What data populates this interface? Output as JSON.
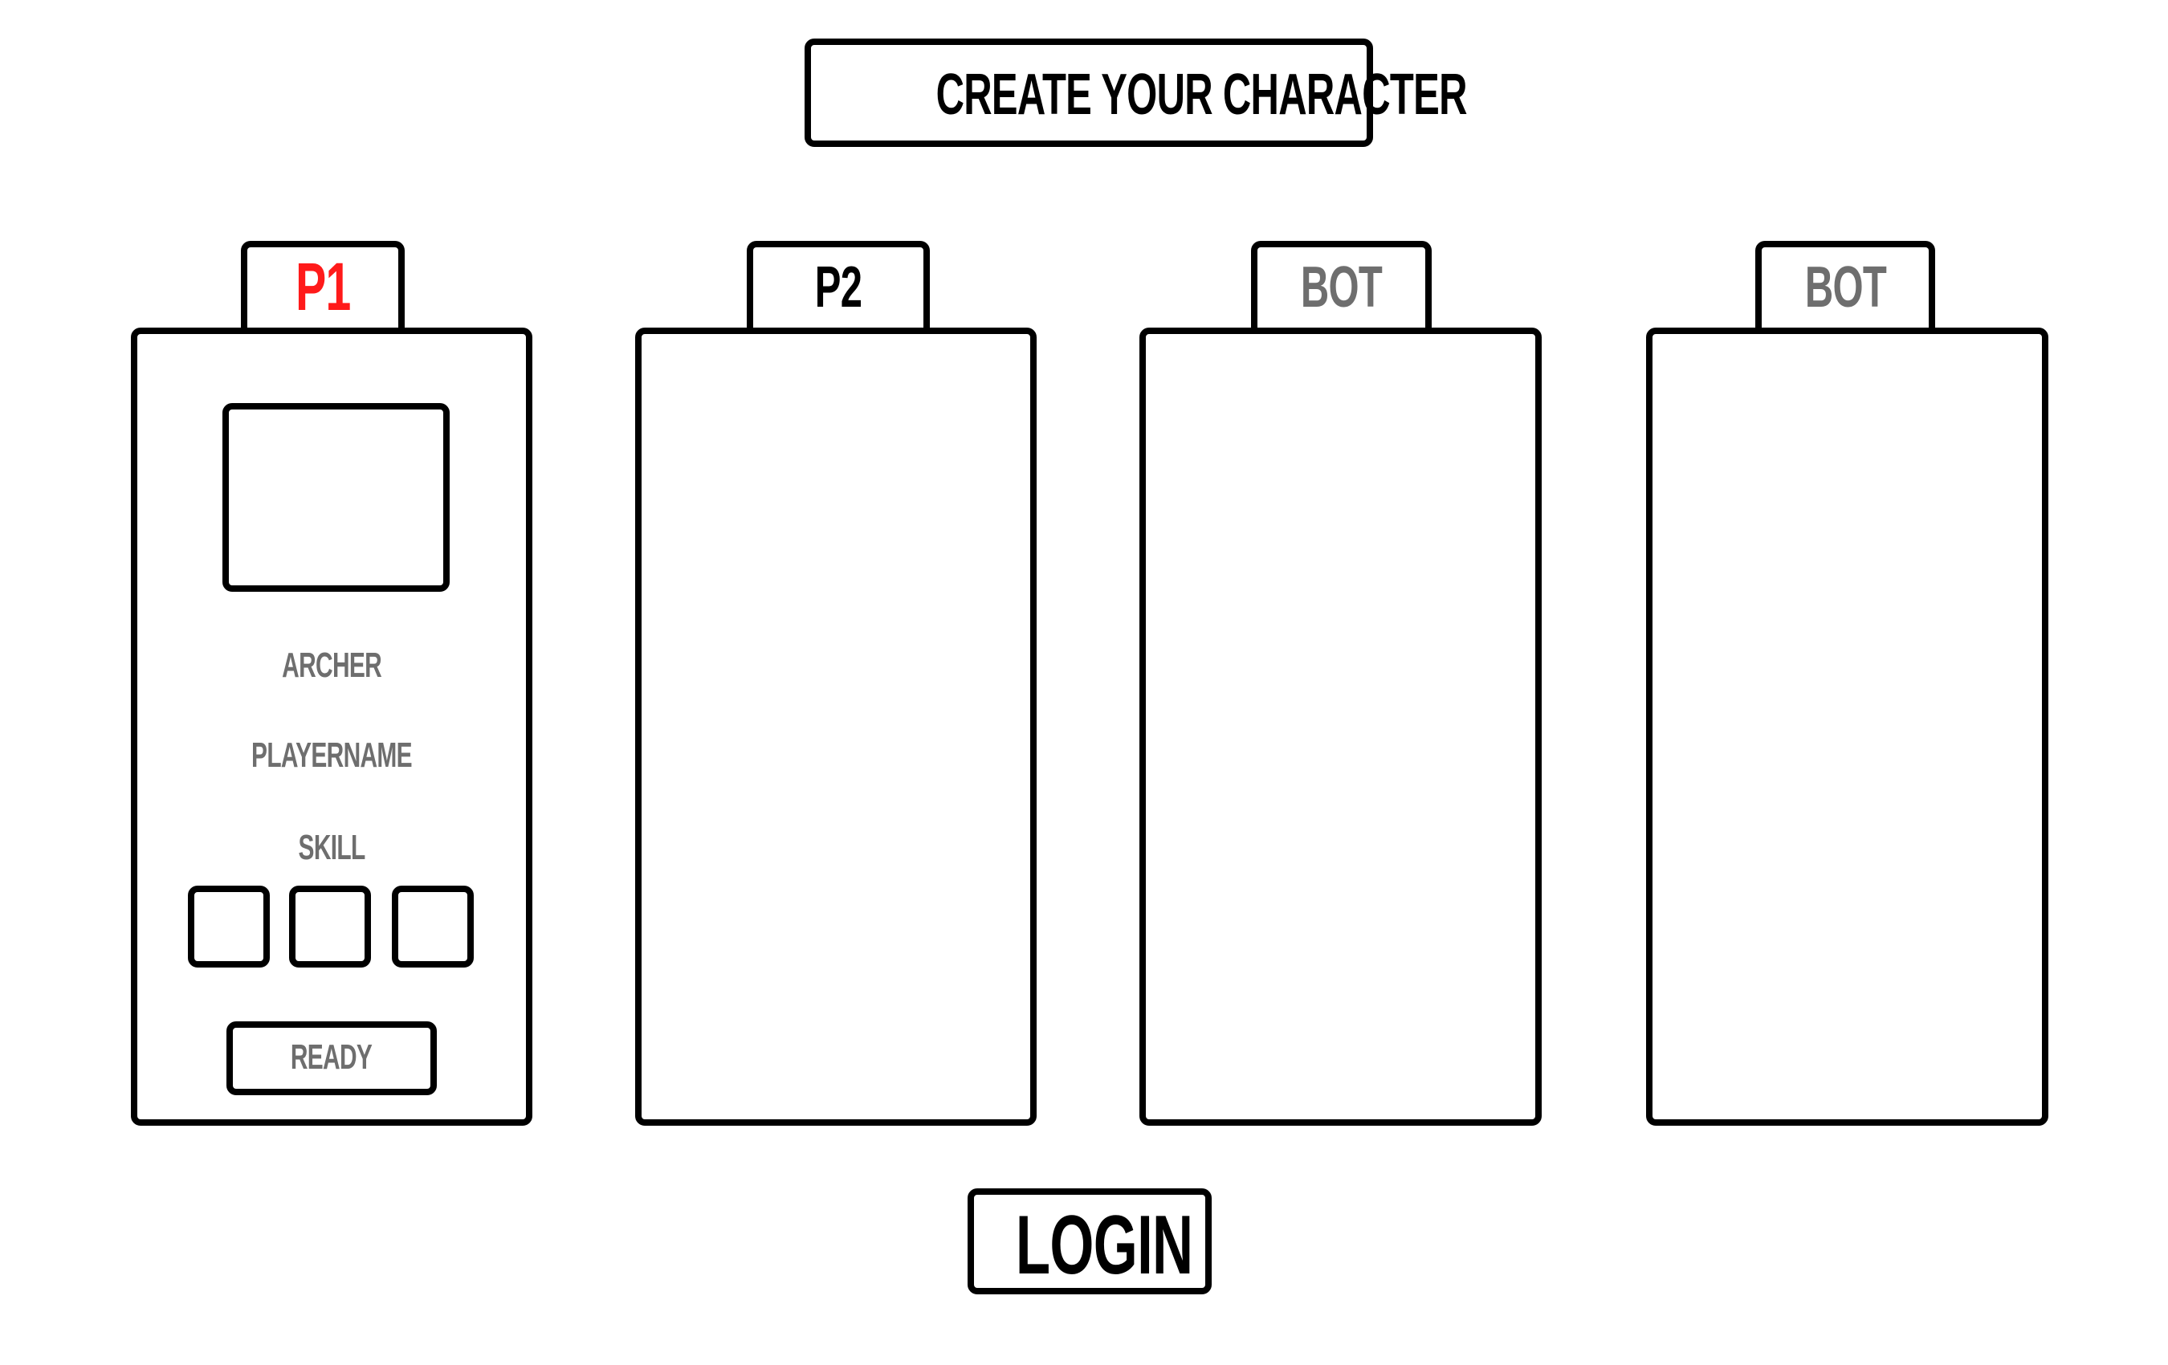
{
  "title": "CREATE YOUR CHARACTER",
  "slots": [
    {
      "tab": "P1",
      "tab_color": "#ff1a1a"
    },
    {
      "tab": "P2",
      "tab_color": "#000000"
    },
    {
      "tab": "BOT",
      "tab_color": "#6e6e6e"
    },
    {
      "tab": "BOT",
      "tab_color": "#6e6e6e"
    }
  ],
  "p1_card": {
    "class_name": "ARCHER",
    "player_name": "PLAYERNAME",
    "skill_label": "SKILL",
    "ready_label": "READY"
  },
  "login_label": "LOGIN"
}
